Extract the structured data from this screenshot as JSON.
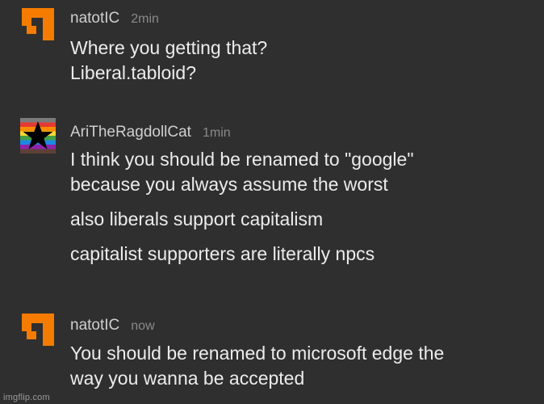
{
  "comments": [
    {
      "username": "natotIC",
      "time": "2min",
      "avatar_icon": "orange-blocky-logo-icon",
      "avatar_color": "#f57c00",
      "lines": [
        "Where you getting that?",
        "Liberal.tabloid?"
      ]
    },
    {
      "username": "AriTheRagdollCat",
      "time": "1min",
      "avatar_icon": "rainbow-flag-star-icon",
      "paragraphs": [
        [
          "I think you should be renamed to \"google\"",
          "because you always assume the worst"
        ],
        [
          "also liberals support capitalism"
        ],
        [
          "capitalist supporters are literally npcs"
        ]
      ]
    },
    {
      "username": "natotIC",
      "time": "now",
      "avatar_icon": "orange-blocky-logo-icon",
      "avatar_color": "#f57c00",
      "lines": [
        "You should be renamed to microsoft edge the",
        "way you wanna be accepted"
      ]
    }
  ],
  "watermark": "imgflip.com",
  "colors": {
    "background": "#2f2f2f",
    "text": "#ececec",
    "username": "#cfcfcf",
    "timestamp": "#8a8a8a",
    "brand_orange": "#f57c00"
  }
}
